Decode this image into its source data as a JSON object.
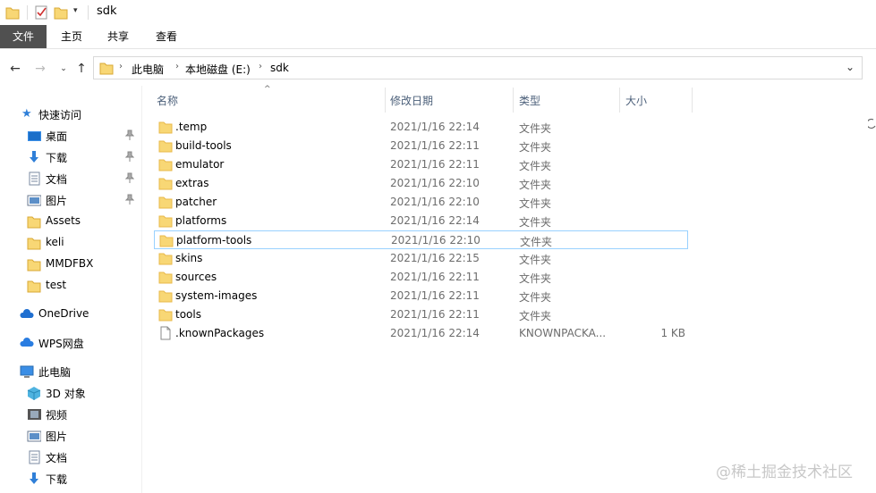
{
  "window": {
    "title": "sdk"
  },
  "ribbon": {
    "tabs": [
      "文件",
      "主页",
      "共享",
      "查看"
    ]
  },
  "address": {
    "crumbs": [
      "此电脑",
      "本地磁盘 (E:)",
      "sdk"
    ]
  },
  "nav": {
    "quick_access": "快速访问",
    "items": [
      {
        "label": "桌面",
        "icon": "desktop-icon",
        "pinned": true
      },
      {
        "label": "下载",
        "icon": "download-icon",
        "pinned": true
      },
      {
        "label": "文档",
        "icon": "documents-icon",
        "pinned": true
      },
      {
        "label": "图片",
        "icon": "pictures-icon",
        "pinned": true
      },
      {
        "label": "Assets",
        "icon": "folder-icon",
        "pinned": false
      },
      {
        "label": "keli",
        "icon": "folder-icon",
        "pinned": false
      },
      {
        "label": "MMDFBX",
        "icon": "folder-icon",
        "pinned": false
      },
      {
        "label": "test",
        "icon": "folder-icon",
        "pinned": false
      }
    ],
    "onedrive": "OneDrive",
    "wps": "WPS网盘",
    "thispc": "此电脑",
    "pc_items": [
      {
        "label": "3D 对象",
        "icon": "3d-objects-icon"
      },
      {
        "label": "视频",
        "icon": "videos-icon"
      },
      {
        "label": "图片",
        "icon": "pictures-icon"
      },
      {
        "label": "文档",
        "icon": "documents-icon"
      },
      {
        "label": "下载",
        "icon": "download-icon"
      }
    ]
  },
  "columns": {
    "name": "名称",
    "date": "修改日期",
    "type": "类型",
    "size": "大小"
  },
  "files": [
    {
      "name": ".temp",
      "date": "2021/1/16 22:14",
      "type": "文件夹",
      "size": "",
      "kind": "folder"
    },
    {
      "name": "build-tools",
      "date": "2021/1/16 22:11",
      "type": "文件夹",
      "size": "",
      "kind": "folder"
    },
    {
      "name": "emulator",
      "date": "2021/1/16 22:11",
      "type": "文件夹",
      "size": "",
      "kind": "folder"
    },
    {
      "name": "extras",
      "date": "2021/1/16 22:10",
      "type": "文件夹",
      "size": "",
      "kind": "folder"
    },
    {
      "name": "patcher",
      "date": "2021/1/16 22:10",
      "type": "文件夹",
      "size": "",
      "kind": "folder"
    },
    {
      "name": "platforms",
      "date": "2021/1/16 22:14",
      "type": "文件夹",
      "size": "",
      "kind": "folder"
    },
    {
      "name": "platform-tools",
      "date": "2021/1/16 22:10",
      "type": "文件夹",
      "size": "",
      "kind": "folder",
      "selected": true
    },
    {
      "name": "skins",
      "date": "2021/1/16 22:15",
      "type": "文件夹",
      "size": "",
      "kind": "folder"
    },
    {
      "name": "sources",
      "date": "2021/1/16 22:11",
      "type": "文件夹",
      "size": "",
      "kind": "folder"
    },
    {
      "name": "system-images",
      "date": "2021/1/16 22:11",
      "type": "文件夹",
      "size": "",
      "kind": "folder"
    },
    {
      "name": "tools",
      "date": "2021/1/16 22:11",
      "type": "文件夹",
      "size": "",
      "kind": "folder"
    },
    {
      "name": ".knownPackages",
      "date": "2021/1/16 22:14",
      "type": "KNOWNPACKA...",
      "size": "1 KB",
      "kind": "file"
    }
  ],
  "watermark": "@稀土掘金技术社区",
  "colors": {
    "folder": "#f8d775",
    "folder_dark": "#e8b84a",
    "selection_border": "#99d1ff",
    "file_tab": "#505050"
  }
}
